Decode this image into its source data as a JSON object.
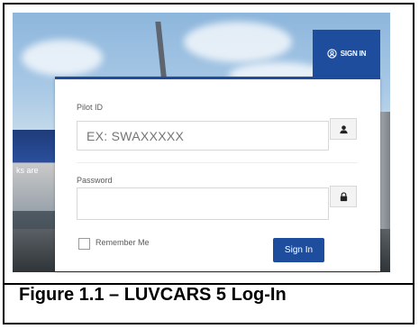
{
  "header": {
    "signin_tab_label": "SIGN IN"
  },
  "form": {
    "pilot_id": {
      "label": "Pilot ID",
      "placeholder": "EX: SWAXXXXX"
    },
    "password": {
      "label": "Password",
      "placeholder": ""
    },
    "remember_me_label": "Remember Me",
    "submit_label": "Sign In"
  },
  "background_texts": [
    "ks are"
  ],
  "caption": "Figure 1.1 – LUVCARS 5 Log-In",
  "colors": {
    "accent": "#1d4d9c"
  },
  "icons": {
    "signin_tab": "user-circle-icon",
    "pilot_id_addon": "user-icon",
    "password_addon": "lock-icon"
  }
}
